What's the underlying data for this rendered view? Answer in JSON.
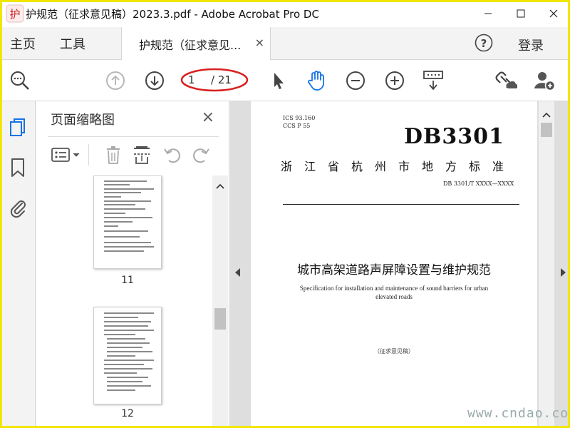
{
  "window": {
    "title": "护规范（征求意见稿）2023.3.pdf - Adobe Acrobat Pro DC",
    "logo_text": "护",
    "controls": [
      "minimize-icon",
      "maximize-icon",
      "close-icon"
    ]
  },
  "menubar": {
    "home": "主页",
    "tools": "工具",
    "doc_tab": "护规范（征求意见...",
    "doc_tab_close": "×",
    "login": "登录"
  },
  "toolbar": {
    "current_page": "1",
    "total_pages": "/ 21",
    "icons": [
      "zoom-search-icon",
      "page-up-icon",
      "page-down-icon",
      "select-cursor-icon",
      "hand-tool-icon",
      "zoom-out-icon",
      "zoom-in-icon",
      "scroll-mode-icon",
      "share-link-icon",
      "add-user-icon"
    ],
    "annotation_color": "#d92020",
    "accent_color": "#1473e6"
  },
  "panel": {
    "title": "页面缩略图",
    "close": "×",
    "thumbnails": [
      {
        "page": "11"
      },
      {
        "page": "12"
      }
    ]
  },
  "document": {
    "ics_line": "ICS  93.160",
    "ccs_line": "CCS  P 55",
    "db_mark": "DB3301",
    "org": "浙江省杭州市地方标准",
    "std_code": "DB 3301/T XXXX—XXXX",
    "title_cn": "城市高架道路声屏障设置与维护规范",
    "title_en": "Specification for installation and maintenance of sound barriers for urban elevated roads",
    "draft_label": "（征求意见稿）"
  },
  "watermark": "www.cndao.com"
}
